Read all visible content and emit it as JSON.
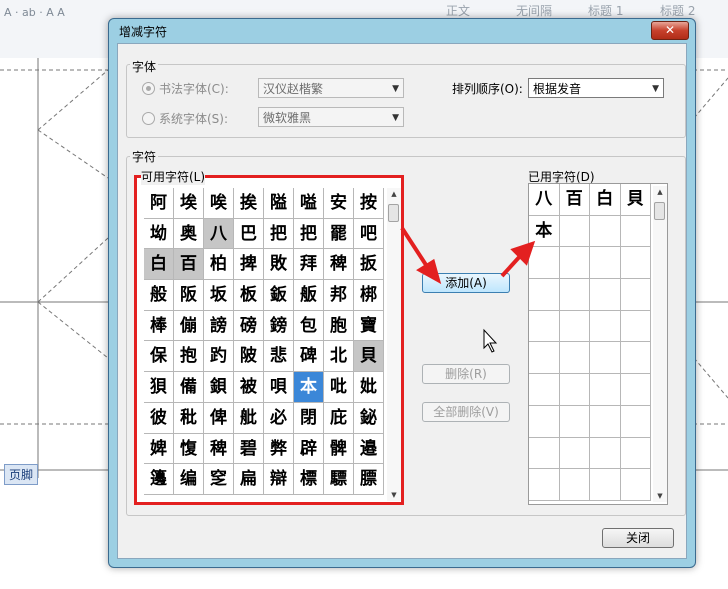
{
  "document": {
    "styles": [
      "正文",
      "无间隔",
      "标题 1",
      "标题 2"
    ],
    "footer_label": "页脚"
  },
  "dialog": {
    "title": "增减字符",
    "close_label": "✕",
    "font_group": {
      "title": "字体",
      "calligraphy_radio": "书法字体(C):",
      "calligraphy_value": "汉仪赵楷繁",
      "system_radio": "系统字体(S):",
      "system_value": "微软雅黑"
    },
    "sort": {
      "label": "排列顺序(O):",
      "value": "根据发音"
    },
    "char_group": {
      "title": "字符",
      "available_label": "可用字符(L)",
      "used_label": "已用字符(D)",
      "available_rows": [
        [
          "阿",
          "埃",
          "唉",
          "挨",
          "隘",
          "嗌",
          "安",
          "按"
        ],
        [
          "坳",
          "奥",
          "八",
          "巴",
          "把",
          "把",
          "罷",
          "吧"
        ],
        [
          "白",
          "百",
          "柏",
          "捭",
          "敗",
          "拜",
          "稗",
          "扳"
        ],
        [
          "般",
          "阪",
          "坂",
          "板",
          "鈑",
          "舨",
          "邦",
          "梆"
        ],
        [
          "棒",
          "傰",
          "謗",
          "磅",
          "鎊",
          "包",
          "胞",
          "寶"
        ],
        [
          "保",
          "抱",
          "趵",
          "陂",
          "悲",
          "碑",
          "北",
          "貝"
        ],
        [
          "狽",
          "備",
          "鋇",
          "被",
          "唄",
          "本",
          "吡",
          "妣"
        ],
        [
          "彼",
          "秕",
          "俾",
          "舭",
          "必",
          "閉",
          "庇",
          "鉍"
        ],
        [
          "婢",
          "愎",
          "稗",
          "碧",
          "弊",
          "辟",
          "髀",
          "邉"
        ],
        [
          "籩",
          "编",
          "窆",
          "扁",
          "辯",
          "標",
          "驃",
          "膘"
        ]
      ],
      "grey_cells": [
        "八",
        "白",
        "百",
        "貝"
      ],
      "selected_cell": "本",
      "used_rows": [
        [
          "八",
          "百",
          "白",
          "貝"
        ],
        [
          "本",
          "",
          "",
          ""
        ]
      ]
    },
    "buttons": {
      "add": "添加(A)",
      "delete": "删除(R)",
      "delete_all": "全部删除(V)",
      "close": "关闭"
    }
  }
}
